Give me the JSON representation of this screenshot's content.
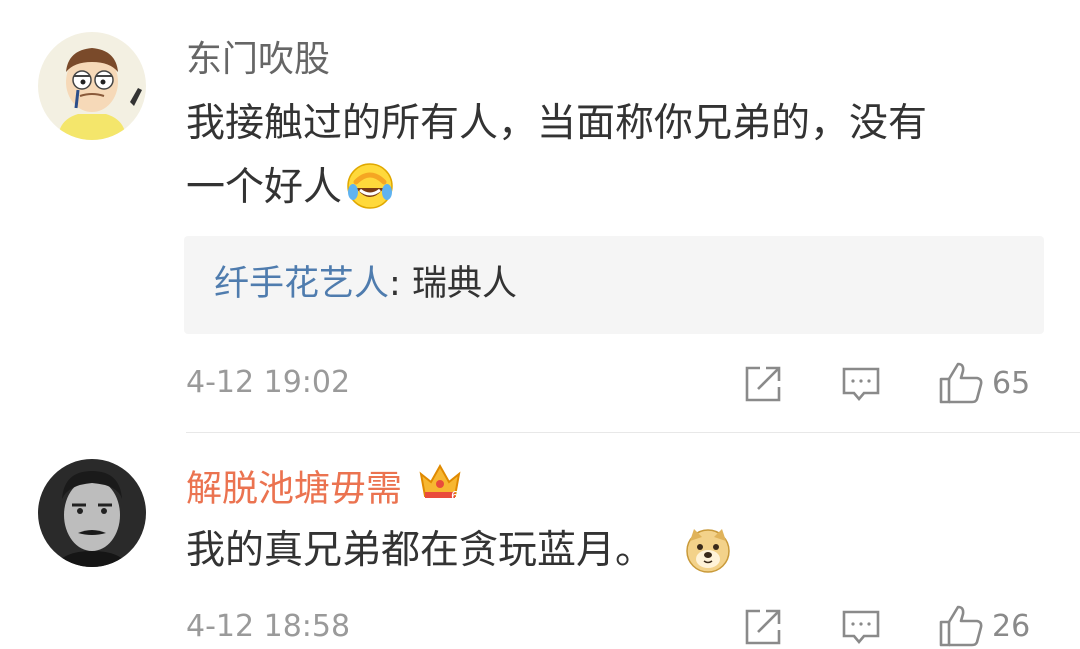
{
  "comments": [
    {
      "username": "东门吹股",
      "username_color": "#666666",
      "content": "我接触过的所有人，当面称你兄弟的，没有",
      "content_line2": "一个好人",
      "emoji": "laugh-cry-emoji",
      "reply": {
        "author": "纤手花艺人",
        "separator": ": ",
        "text": "瑞典人"
      },
      "timestamp": "4-12 19:02",
      "likes": "65"
    },
    {
      "username": "解脱池塘毋需",
      "username_color": "#eb7350",
      "badge": "crown-icon",
      "content": "我的真兄弟都在贪玩蓝月。",
      "emoji": "doge-emoji",
      "timestamp": "4-12 18:58",
      "likes": "26"
    }
  ],
  "icons": {
    "share": "share-icon",
    "comment": "comment-icon",
    "like": "thumbs-up-icon"
  },
  "colors": {
    "link_blue": "#4f7cae",
    "vip_orange": "#eb7350",
    "text": "#333333",
    "muted": "#9a9a9a"
  }
}
